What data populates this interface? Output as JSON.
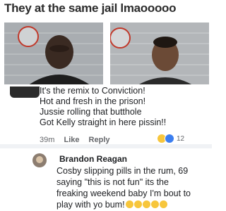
{
  "post": {
    "caption": "They at the same jail lmaooooo"
  },
  "comment_1": {
    "lines": [
      "It's the remix to Conviction!",
      "Hot and fresh in the prison!",
      "Jussie rolling that butthole",
      "Got Kelly straight in here pissin!!"
    ],
    "time": "39m",
    "like_label": "Like",
    "reply_label": "Reply",
    "reaction_count": "12",
    "reaction_icons": [
      "haha-emoji-icon",
      "like-emoji-icon"
    ]
  },
  "comment_2": {
    "author": "Brandon Reagan",
    "lines": [
      "Cosby slipping pills in the rum, 69",
      "saying \"this is not fun\" its the",
      "freaking weekend baby I'm bout to",
      "play with yo bum!"
    ],
    "trailing_emojis": [
      "laughing-emoji-icon",
      "laughing-emoji-icon",
      "laughing-emoji-icon",
      "laughing-emoji-icon",
      "laughing-emoji-icon"
    ]
  },
  "colors": {
    "text": "#1c1e21",
    "meta": "#65676b",
    "reaction_yellow": "#f7c63c",
    "reaction_blue": "#3b7ef0"
  }
}
